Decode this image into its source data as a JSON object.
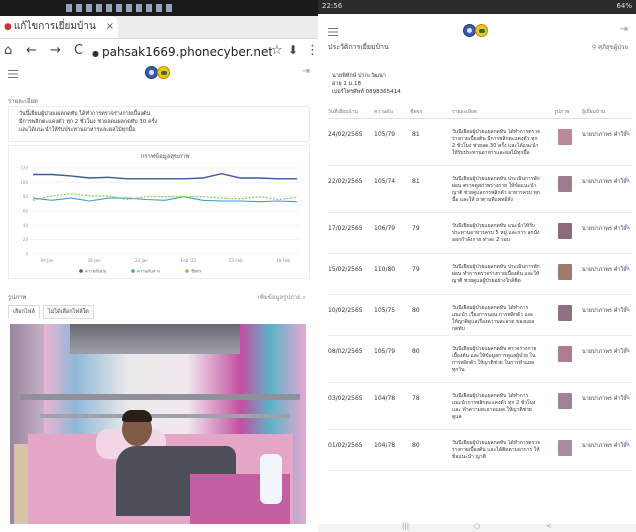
{
  "left": {
    "tab": {
      "title": "แก้ไขการเยี่ยมบ้าน",
      "close": "×"
    },
    "browser": {
      "back": "←",
      "forward": "→",
      "reload": "C",
      "url": "pahsak1669.phonecyber.net/r",
      "star": "☆",
      "download": "⬇",
      "more": "⋮",
      "exit_icon": "⇥"
    },
    "section_title": "รายละเอียด",
    "info_lines": [
      "วันนี้เยี่ยมผู้ป่วยแผลกดทับ ได้ทำการตรวจร่างกายเบื้องต้น",
      "มีการพลิกตะแคงตัว ทุก 2 ชั่วโมง ช่วยลดแผลกดทับ 30 ครั้ง",
      "และได้แนะนำให้รับประทานอาหารและผลไม้ทุกมื้อ"
    ],
    "chart_title": "กราฟข้อมูลสุขภาพ",
    "photo_section": "รูปภาพ",
    "photo_link": "เพิ่มข้อมูลรูปถ่าย",
    "photo_tabs": [
      "เลือกไฟล์",
      "ไม่ได้เลือกไฟล์ใด"
    ]
  },
  "chart_data": {
    "type": "line",
    "title": "กราฟข้อมูลสุขภาพ",
    "x": [
      "09 Jan",
      "16 Jan",
      "23 Jan",
      "Feb '22",
      "13 Feb",
      "19 Feb"
    ],
    "xlabel": "",
    "ylabel": "",
    "ylim": [
      0,
      120
    ],
    "yticks": [
      0,
      20,
      40,
      60,
      80,
      100,
      120
    ],
    "grid": true,
    "legend": "bottom",
    "series": [
      {
        "name": "ความดันบน",
        "color": "#3a5a9c",
        "values": [
          111,
          111,
          109,
          106,
          107,
          105,
          105,
          105,
          105,
          106,
          112,
          106,
          106,
          105,
          105
        ]
      },
      {
        "name": "ความดันล่าง",
        "color": "#3aa0c8",
        "values": [
          78,
          75,
          78,
          74,
          78,
          78,
          76,
          75,
          80,
          75,
          74,
          74,
          73,
          74,
          73
        ]
      },
      {
        "name": "ชีพจร",
        "color": "#7fc94a",
        "values": [
          75,
          81,
          84,
          81,
          81,
          76,
          80,
          80,
          80,
          80,
          78,
          77,
          80,
          76,
          79
        ]
      }
    ]
  },
  "right": {
    "status_time": "22:56",
    "status_right": "64%",
    "page_title": "ประวัติการเยี่ยมบ้าน",
    "user": "ศุภิสุขผู้ป่วย",
    "person": {
      "name": "นายพิทักษ์ ปากะวัฒนา",
      "age": "อายุ 1 ม.18",
      "phone": "เบอร์โทรศัพท์ 0898365414"
    },
    "columns": [
      "วันที่เยี่ยมบ้าน",
      "ความดัน",
      "ชีพจร",
      "รายละเอียด",
      "รูปภาพ",
      "ผู้เยี่ยมบ้าน"
    ],
    "rows": [
      {
        "date": "24/02/2565",
        "bp": "105/79",
        "pulse": "81",
        "note": "วันนี้เยี่ยมผู้ป่วยแผลกดทับ ได้ทำการตรวจร่างกายเบื้องต้น มีการพลิกตะแคงตัว ทุก 2 ชั่วโมง ช่วยลด 30 ครั้ง และได้แนะนำให้รับประทานอาหารและผลไม้ทุกมื้อ",
        "by": "นายปาภาพร คำใจ",
        "thumb": "#b88a9a"
      },
      {
        "date": "22/02/2565",
        "bp": "105/74",
        "pulse": "81",
        "note": "วันนี้เยี่ยมผู้ป่วยแผลกดทับ ประเมินการพักผ่อน ตรวจดูสภาพร่างกาย ให้ข้อแนะนำ ญาติ ช่วยดูแลการพลิกตัว อาหารครบ ทุกมื้อ และให้ ยาตามที่แพทย์สั่ง",
        "by": "นายปาภาพร คำใจ",
        "thumb": "#9a7d8e"
      },
      {
        "date": "17/02/2565",
        "bp": "106/79",
        "pulse": "79",
        "note": "วันนี้เยี่ยมผู้ป่วยแผลกดทับ แนะนำให้รับประทานอาหารครบ 5 หมู่ และการ ลุกนั่ง ออกกำลังกาย ท่าละ 2 รอบ",
        "by": "นายปาภาพร คำใจ",
        "thumb": "#8f6a7a"
      },
      {
        "date": "15/02/2565",
        "bp": "110/80",
        "pulse": "79",
        "note": "วันนี้เยี่ยมผู้ป่วยแผลกดทับ ประเมินการพักผ่อน ทำการตรวจร่างกายเบื้องต้น และให้ญาติ ช่วยดูแลผู้ป่วยอย่างใกล้ชิด",
        "by": "นายปาภาพร คำใจ",
        "thumb": "#a07a6c"
      },
      {
        "date": "10/02/2565",
        "bp": "105/75",
        "pulse": "80",
        "note": "วันนี้เยี่ยมผู้ป่วยแผลกดทับ ได้ทำการแนะนำ เรื่องการนอน การพลิกตัว และ ให้ญาติดูแลเรื่องความสะอาด ของแผลกดทับ",
        "by": "นายปาภาพร คำใจ",
        "thumb": "#8e7180"
      },
      {
        "date": "08/02/2565",
        "bp": "105/79",
        "pulse": "80",
        "note": "วันนี้เยี่ยมผู้ป่วยแผลกดทับ ตรวจร่างกายเบื้องต้น และให้ข้อมูลการดูแลผู้ป่วย ในการพลิกตัว ให้ญาติช่วย ในการทำแผลทุกวัน",
        "by": "นายปาภาพร คำใจ",
        "thumb": "#b07a92"
      },
      {
        "date": "03/02/2565",
        "bp": "104/78",
        "pulse": "78",
        "note": "วันนี้เยี่ยมผู้ป่วยแผลกดทับ ได้ทำการ แนะนำการพลิกตะแคงตัว ทุก 2 ชั่วโมง และ ทำความสะอาดแผล ให้ญาติช่วยดูแล",
        "by": "นายปาภาพร คำใจ",
        "thumb": "#9c8496"
      },
      {
        "date": "01/02/2565",
        "bp": "104/78",
        "pulse": "80",
        "note": "วันนี้เยี่ยมผู้ป่วยแผลกดทับ ได้ทำการตรวจร่างกายเบื้องต้น และได้ติดตามอาการ ให้ข้อแนะนำ ญาติ",
        "by": "นายปาภาพร คำใจ",
        "thumb": "#a88c9c"
      }
    ],
    "navbar": [
      "|||",
      "○",
      "<"
    ]
  }
}
